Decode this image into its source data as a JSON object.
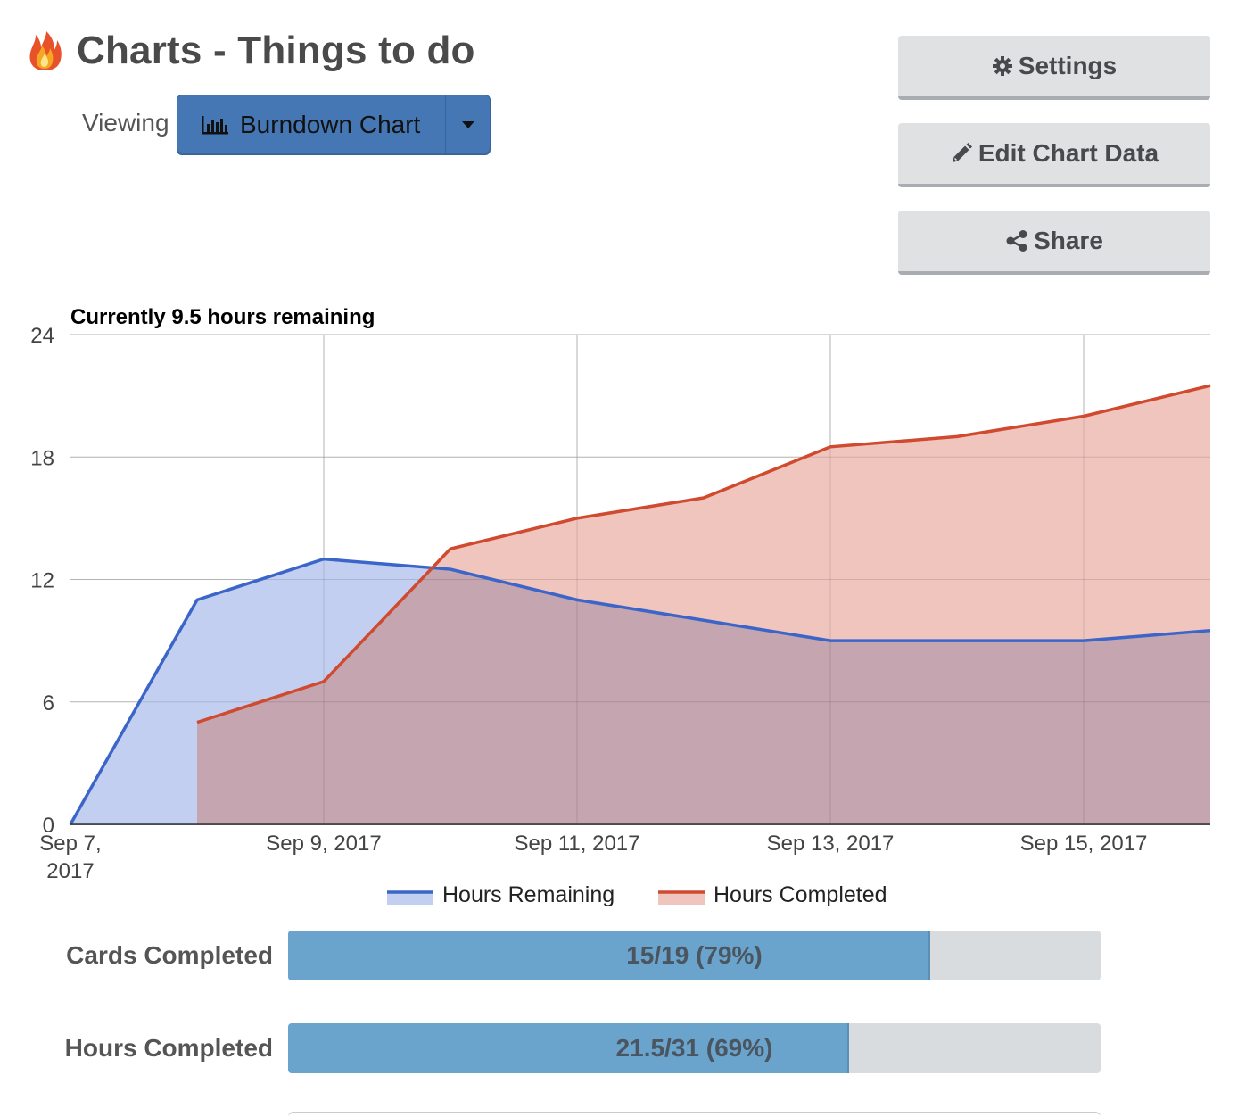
{
  "header": {
    "title": "Charts - Things to do",
    "viewing_label": "Viewing",
    "view_selector": {
      "selected": "Burndown Chart",
      "icon": "bar-chart-icon"
    }
  },
  "actions": {
    "settings": {
      "label": "Settings",
      "icon": "gear-icon"
    },
    "edit_chart_data": {
      "label": "Edit Chart Data",
      "icon": "pencil-icon"
    },
    "share": {
      "label": "Share",
      "icon": "share-icon"
    }
  },
  "colors": {
    "remaining": "#3b65c8",
    "remaining_fill": "#c3cff0",
    "completed": "#cf4a2e",
    "completed_fill": "#f0c5bd",
    "overlap_fill": "#c5a5b0",
    "button_blue": "#4577b5",
    "progress_fill": "#6aa3cc"
  },
  "chart_data": {
    "type": "area",
    "title": "Currently 9.5 hours remaining",
    "x": [
      "2017-09-07",
      "2017-09-08",
      "2017-09-09",
      "2017-09-10",
      "2017-09-11",
      "2017-09-12",
      "2017-09-13",
      "2017-09-14",
      "2017-09-15",
      "2017-09-16"
    ],
    "x_tick_labels": [
      {
        "x": "2017-09-07",
        "lines": [
          "Sep 7,",
          "2017"
        ]
      },
      {
        "x": "2017-09-09",
        "lines": [
          "Sep 9, 2017"
        ]
      },
      {
        "x": "2017-09-11",
        "lines": [
          "Sep 11, 2017"
        ]
      },
      {
        "x": "2017-09-13",
        "lines": [
          "Sep 13, 2017"
        ]
      },
      {
        "x": "2017-09-15",
        "lines": [
          "Sep 15, 2017"
        ]
      }
    ],
    "y_ticks": [
      0,
      6,
      12,
      18,
      24
    ],
    "ylim": [
      0,
      24
    ],
    "grid": true,
    "legend_position": "bottom",
    "series": [
      {
        "name": "Hours Remaining",
        "values": [
          0,
          11,
          13,
          12.5,
          11,
          10,
          9,
          9,
          9,
          9.5
        ]
      },
      {
        "name": "Hours Completed",
        "values": [
          null,
          5,
          7,
          13.5,
          15,
          16,
          18.5,
          19,
          20,
          21.5
        ]
      }
    ]
  },
  "stats": [
    {
      "label": "Cards Completed",
      "text": "15/19 (79%)",
      "fraction": 0.79
    },
    {
      "label": "Hours Completed",
      "text": "21.5/31 (69%)",
      "fraction": 0.69
    }
  ]
}
